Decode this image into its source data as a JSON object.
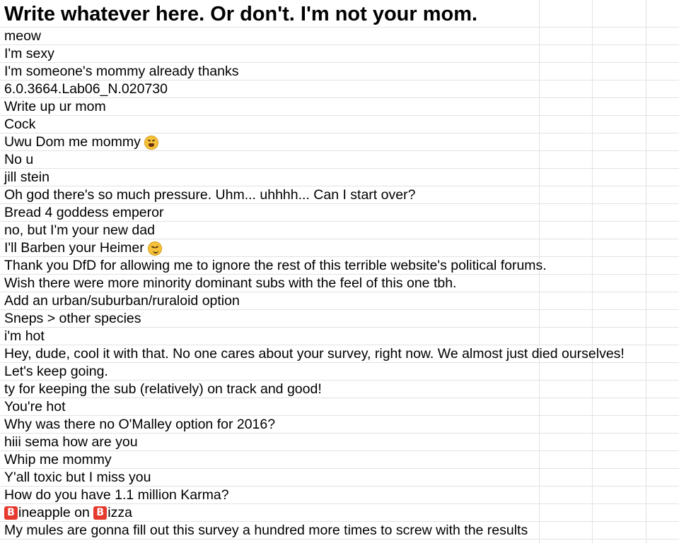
{
  "sheet": {
    "header": "Write whatever here. Or don't. I'm not your mom.",
    "rows": [
      "meow",
      "I'm sexy",
      "I'm someone's mommy already thanks",
      "6.0.3664.Lab06_N.020730",
      "Write up ur mom",
      "Cock",
      "Uwu Dom me mommy",
      "No u",
      "jill stein",
      "Oh god there's so much pressure. Uhm... uhhhh... Can I start over?",
      "Bread 4 goddess emperor",
      "no, but I'm your new dad",
      "I'll Barben your Heimer",
      "Thank you DfD for allowing me to ignore the rest of this terrible website's political forums.",
      "Wish there were more minority dominant subs with the feel of this one tbh.",
      "Add an urban/suburban/ruraloid option",
      "Sneps > other species",
      "i'm hot",
      "Hey, dude, cool it with that. No one cares about your survey, right now. We almost just died ourselves!",
      "Let's keep going.",
      "ty for keeping the sub (relatively) on track and good!",
      "You're hot",
      "Why was there no O'Malley option for 2016?",
      "hiii sema how are you",
      "Whip me mommy",
      "Y'all toxic but I miss you",
      "How do you have 1.1 million Karma?",
      {
        "b1": "B",
        "t1": "ineapple on ",
        "b2": "B",
        "t2": "izza"
      },
      "My mules are gonna fill out this survey a hundred more times to screw with the results"
    ],
    "emoji": {
      "row7": "weary-face-icon",
      "row13": "smirking-face-icon"
    }
  }
}
